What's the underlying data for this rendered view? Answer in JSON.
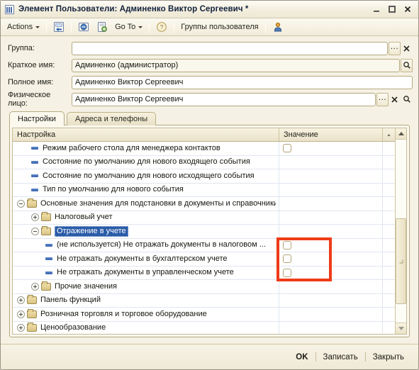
{
  "window": {
    "title": "Элемент Пользователи: Админенко Виктор Сергеевич *",
    "icon": "app-grid-icon",
    "minimize_label": "_",
    "maximize_label": "□",
    "close_label": "✕"
  },
  "toolbar": {
    "actions_label": "Actions",
    "goto_label": "Go To",
    "user_groups_label": "Группы пользователя",
    "icons": [
      "save-and-close-icon",
      "refresh-icon",
      "create-copy-icon",
      "help-icon",
      "user-icon"
    ]
  },
  "form": {
    "fields": [
      {
        "label": "Группа:",
        "value": "",
        "dim": false,
        "buttons": [
          "select-button",
          "clear-button"
        ]
      },
      {
        "label": "Краткое имя:",
        "value": "Админенко (администратор)",
        "dim": true,
        "buttons": [
          "open-button"
        ]
      },
      {
        "label": "Полное имя:",
        "value": "Админенко Виктор Сергеевич",
        "dim": false,
        "buttons": []
      },
      {
        "label": "Физическое лицо:",
        "value": "Админенко Виктор Сергеевич",
        "dim": false,
        "buttons": [
          "select-button",
          "clear-button",
          "open-button"
        ]
      }
    ]
  },
  "tabs": [
    {
      "label": "Настройки",
      "active": true
    },
    {
      "label": "Адреса и телефоны",
      "active": false
    }
  ],
  "grid": {
    "columns": [
      {
        "key": "setting",
        "label": "Настройка"
      },
      {
        "key": "value",
        "label": "Значение"
      }
    ],
    "sort_indicator": "▲",
    "rows": [
      {
        "indent": 1,
        "marker": "dash",
        "text": "Режим рабочего стола для менеджера контактов",
        "checkbox": true,
        "selected": false,
        "expanded": null
      },
      {
        "indent": 1,
        "marker": "dash",
        "text": "Состояние по умолчанию для нового входящего события",
        "checkbox": false,
        "selected": false,
        "expanded": null
      },
      {
        "indent": 1,
        "marker": "dash",
        "text": "Состояние по умолчанию для нового исходящего события",
        "checkbox": false,
        "selected": false,
        "expanded": null
      },
      {
        "indent": 1,
        "marker": "dash",
        "text": "Тип по умолчанию для нового события",
        "checkbox": false,
        "selected": false,
        "expanded": null
      },
      {
        "indent": 0,
        "marker": "folder",
        "text": "Основные значения для подстановки в документы и справочники",
        "checkbox": false,
        "selected": false,
        "expanded": true
      },
      {
        "indent": 1,
        "marker": "folder",
        "text": "Налоговый учет",
        "checkbox": false,
        "selected": false,
        "expanded": false
      },
      {
        "indent": 1,
        "marker": "folder",
        "text": "Отражение в учете",
        "checkbox": false,
        "selected": true,
        "expanded": true
      },
      {
        "indent": 2,
        "marker": "dash",
        "text": "(не используется) Не отражать документы в налоговом ...",
        "checkbox": true,
        "selected": false,
        "expanded": null
      },
      {
        "indent": 2,
        "marker": "dash",
        "text": "Не отражать документы в бухгалтерском учете",
        "checkbox": true,
        "selected": false,
        "expanded": null
      },
      {
        "indent": 2,
        "marker": "dash",
        "text": "Не отражать документы в управленческом учете",
        "checkbox": true,
        "selected": false,
        "expanded": null
      },
      {
        "indent": 1,
        "marker": "folder",
        "text": "Прочие значения",
        "checkbox": false,
        "selected": false,
        "expanded": false
      },
      {
        "indent": 0,
        "marker": "folder",
        "text": "Панель функций",
        "checkbox": false,
        "selected": false,
        "expanded": false
      },
      {
        "indent": 0,
        "marker": "folder",
        "text": "Розничная торговля и торговое оборудование",
        "checkbox": false,
        "selected": false,
        "expanded": false
      },
      {
        "indent": 0,
        "marker": "folder",
        "text": "Ценообразование",
        "checkbox": false,
        "selected": false,
        "expanded": false
      }
    ]
  },
  "annotation": {
    "color": "#ef3b18",
    "shape": "rectangle",
    "target": "checkbox-column-highlight"
  },
  "footer": {
    "ok_label": "OK",
    "write_label": "Записать",
    "close_label": "Закрыть"
  },
  "colors": {
    "window_bg": "#f5f1e4",
    "field_border": "#b5a97f",
    "selection": "#2a5ca8",
    "annotation": "#ef3b18"
  }
}
